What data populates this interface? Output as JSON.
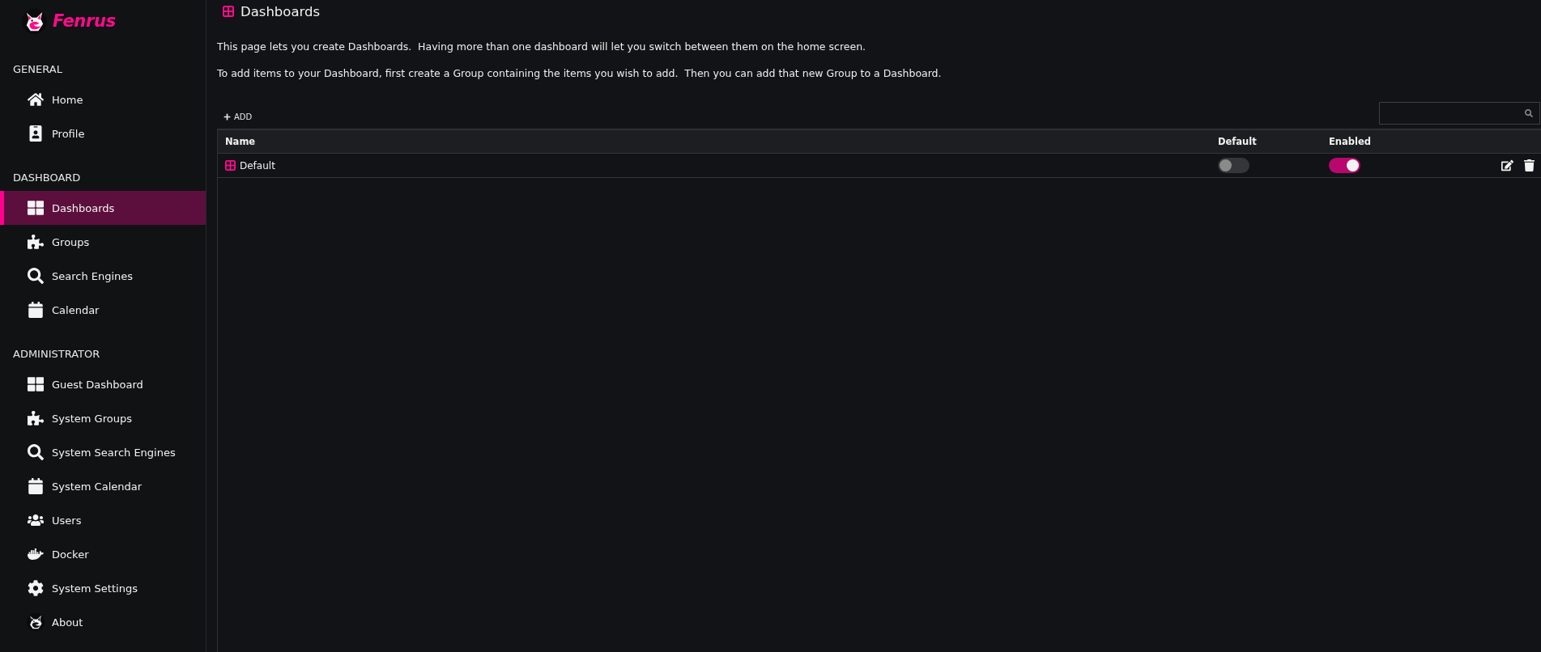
{
  "brand": {
    "name": "Fenrus"
  },
  "sidebar": {
    "sections": [
      {
        "heading": "GENERAL",
        "items": [
          {
            "label": "Home",
            "selected": false
          },
          {
            "label": "Profile",
            "selected": false
          }
        ]
      },
      {
        "heading": "DASHBOARD",
        "items": [
          {
            "label": "Dashboards",
            "selected": true
          },
          {
            "label": "Groups",
            "selected": false
          },
          {
            "label": "Search Engines",
            "selected": false
          },
          {
            "label": "Calendar",
            "selected": false
          }
        ]
      },
      {
        "heading": "ADMINISTRATOR",
        "items": [
          {
            "label": "Guest Dashboard",
            "selected": false
          },
          {
            "label": "System Groups",
            "selected": false
          },
          {
            "label": "System Search Engines",
            "selected": false
          },
          {
            "label": "System Calendar",
            "selected": false
          },
          {
            "label": "Users",
            "selected": false
          },
          {
            "label": "Docker",
            "selected": false
          },
          {
            "label": "System Settings",
            "selected": false
          },
          {
            "label": "About",
            "selected": false
          }
        ]
      }
    ]
  },
  "page": {
    "title": "Dashboards",
    "paragraphs": [
      "This page lets you create Dashboards.  Having more than one dashboard will let you switch between them on the home screen.",
      "To add items to your Dashboard, first create a Group containing the items you wish to add.  Then you can add that new Group to a Dashboard."
    ]
  },
  "toolbar": {
    "add_label": "ADD"
  },
  "table": {
    "columns": [
      "Name",
      "Default",
      "Enabled"
    ],
    "rows": [
      {
        "name": "Default",
        "default": false,
        "enabled": true
      }
    ]
  }
}
